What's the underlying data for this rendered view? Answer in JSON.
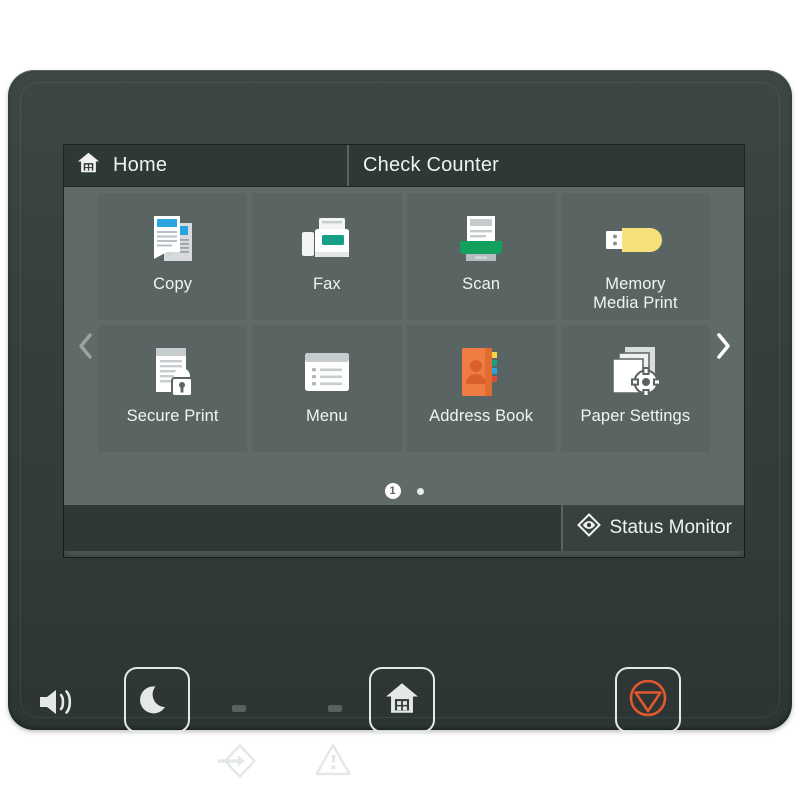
{
  "device": {
    "name": "printer-control-panel"
  },
  "screen": {
    "header": {
      "home_label": "Home",
      "home_icon": "home-icon",
      "counter_label": "Check Counter"
    },
    "nav": {
      "prev_icon": "chevron-left-icon",
      "next_icon": "chevron-right-icon"
    },
    "tiles": [
      {
        "label": "Copy",
        "icon": "copy-documents-icon"
      },
      {
        "label": "Fax",
        "icon": "fax-machine-icon"
      },
      {
        "label": "Scan",
        "icon": "scanner-icon"
      },
      {
        "label": "Memory\nMedia Print",
        "icon": "usb-drive-icon"
      },
      {
        "label": "Secure Print",
        "icon": "document-lock-icon"
      },
      {
        "label": "Menu",
        "icon": "menu-list-icon"
      },
      {
        "label": "Address Book",
        "icon": "address-book-icon"
      },
      {
        "label": "Paper Settings",
        "icon": "paper-gear-icon"
      }
    ],
    "pagination": {
      "current_page": "1",
      "total_pages": 2
    },
    "footer": {
      "status_monitor_label": "Status Monitor",
      "status_monitor_icon": "diamond-eye-icon"
    }
  },
  "hardware": {
    "buttons": [
      {
        "name": "sleep-button",
        "icon": "crescent-moon-icon"
      },
      {
        "name": "home-button",
        "icon": "home-icon"
      },
      {
        "name": "stop-button",
        "icon": "stop-triangle-icon"
      }
    ],
    "speaker_icon": "speaker-volume-icon",
    "indicators": [
      {
        "name": "data-indicator",
        "icon": "arrow-into-diamond-icon"
      },
      {
        "name": "error-indicator",
        "icon": "warning-triangle-icon"
      }
    ]
  },
  "colors": {
    "bezel": "#363f3d",
    "screen_bg": "#4e5856",
    "header_bg": "#2e3836",
    "tile_bg": "#5a6462",
    "grid_bg": "#606a68",
    "accent_blue": "#2aa3df",
    "accent_teal": "#13a085",
    "accent_green": "#13a05e",
    "accent_yellow": "#f5e07a",
    "accent_orange": "#ef7d43",
    "stop_red": "#e2572e",
    "text": "#f0f2f1"
  }
}
